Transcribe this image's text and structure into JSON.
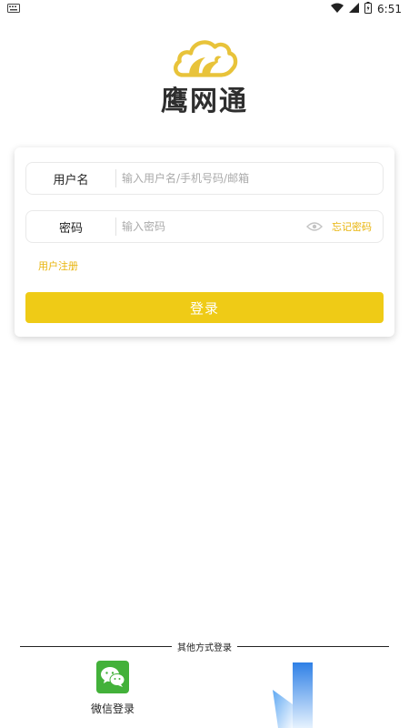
{
  "status_bar": {
    "time": "6:51",
    "left_icon": "keyboard-icon",
    "right_icons": [
      "wifi-icon",
      "signal-icon",
      "battery-icon"
    ]
  },
  "logo": {
    "text": "鹰网通",
    "icon": "cloud-eagle-logo",
    "color": "#e8c33a"
  },
  "login_form": {
    "username": {
      "label": "用户名",
      "placeholder": "输入用户名/手机号码/邮箱",
      "value": ""
    },
    "password": {
      "label": "密码",
      "placeholder": "输入密码",
      "value": "",
      "visibility_icon": "eye-icon",
      "forgot_link": "忘记密码"
    },
    "register_link": "用户注册",
    "login_button": "登录"
  },
  "other_login": {
    "divider_text": "其他方式登录",
    "options": [
      {
        "label": "微信登录",
        "icon": "wechat-icon"
      }
    ]
  },
  "colors": {
    "accent": "#efcb16",
    "link": "#e8b40c",
    "wechat_green": "#43b13a"
  }
}
